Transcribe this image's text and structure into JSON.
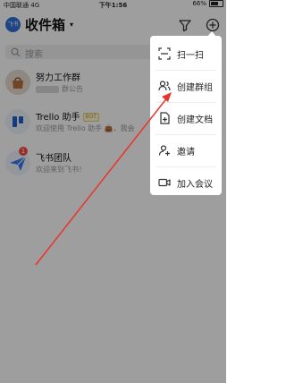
{
  "status": {
    "carrier": "中国联通",
    "network": "4G",
    "time": "下午1:56",
    "battery": "66%",
    "battery_level": 0.66
  },
  "header": {
    "avatar_text": "飞书",
    "title": "收件箱",
    "caret": "▾"
  },
  "search": {
    "placeholder": "搜索"
  },
  "conversations": [
    {
      "name": "努力工作群",
      "subtitle": "群公告",
      "avatar_color": "#c8c0b8"
    },
    {
      "name": "Trello 助手",
      "tag": "BOT",
      "subtitle": "欢迎使用 Trello 助手 👜，我会",
      "avatar_color": "#eef3fb"
    },
    {
      "name": "飞书团队",
      "subtitle": "欢迎来到飞书！",
      "badge": "1",
      "avatar_color": "#eef3fb"
    }
  ],
  "menu": {
    "items": [
      {
        "label": "扫一扫",
        "icon": "scan-icon"
      },
      {
        "label": "创建群组",
        "icon": "create-group-icon"
      },
      {
        "label": "创建文档",
        "icon": "create-doc-icon"
      },
      {
        "label": "邀请",
        "icon": "invite-icon"
      },
      {
        "label": "加入会议",
        "icon": "join-meeting-icon"
      }
    ]
  },
  "colors": {
    "overlay": "rgba(0,0,0,0.38)",
    "arrow": "#e8342a",
    "brand_blue": "#2f6fd6",
    "badge_red": "#f54a45"
  }
}
